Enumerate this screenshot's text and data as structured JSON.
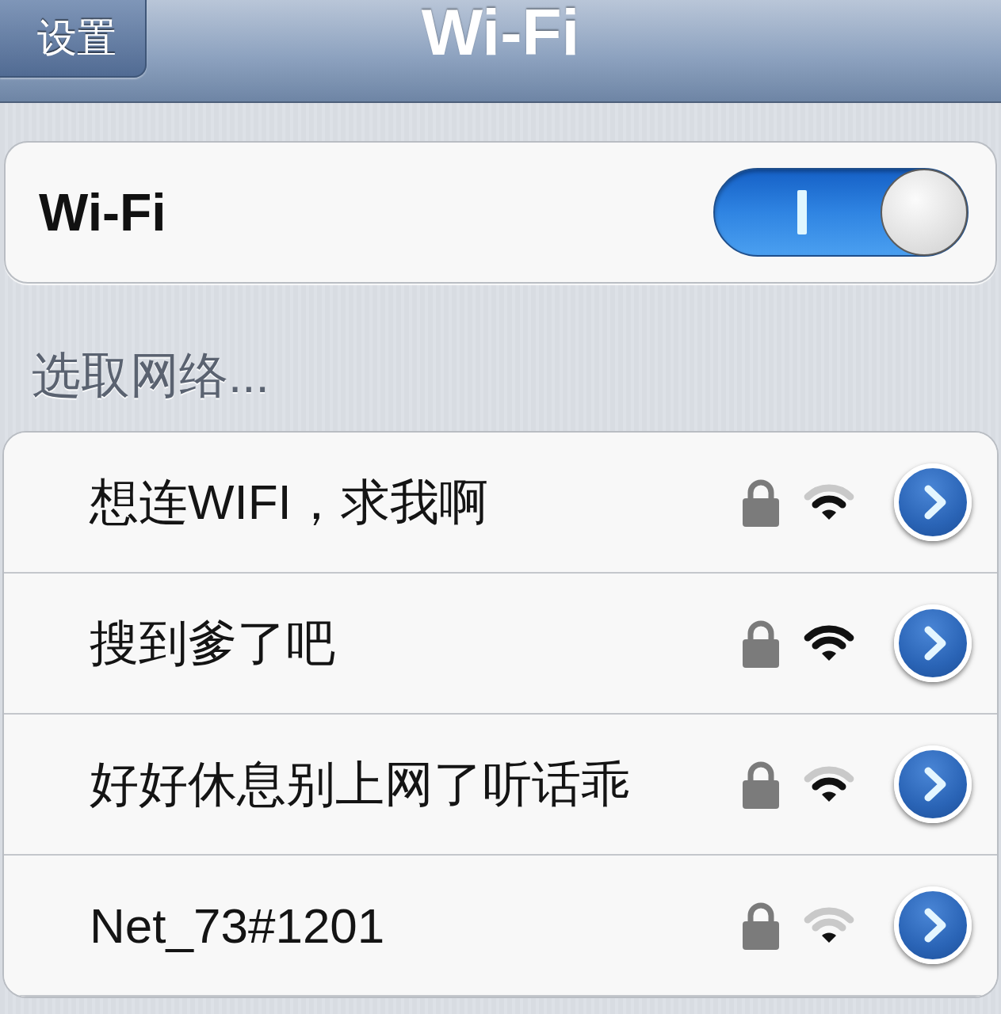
{
  "nav_bar": {
    "back_button": "设置",
    "title": "Wi-Fi"
  },
  "wifi_switch": {
    "label": "Wi-Fi",
    "on": true
  },
  "networks_section": {
    "header": "选取网络..."
  },
  "networks": [
    {
      "name": "想连WIFI，求我啊",
      "secured": true,
      "kind": "medium"
    },
    {
      "name": "搜到爹了吧",
      "secured": true,
      "kind": "strong"
    },
    {
      "name": "好好休息别上网了听话乖",
      "secured": true,
      "kind": "medium"
    },
    {
      "name": "Net_73#1201",
      "secured": true,
      "kind": "weak"
    }
  ]
}
